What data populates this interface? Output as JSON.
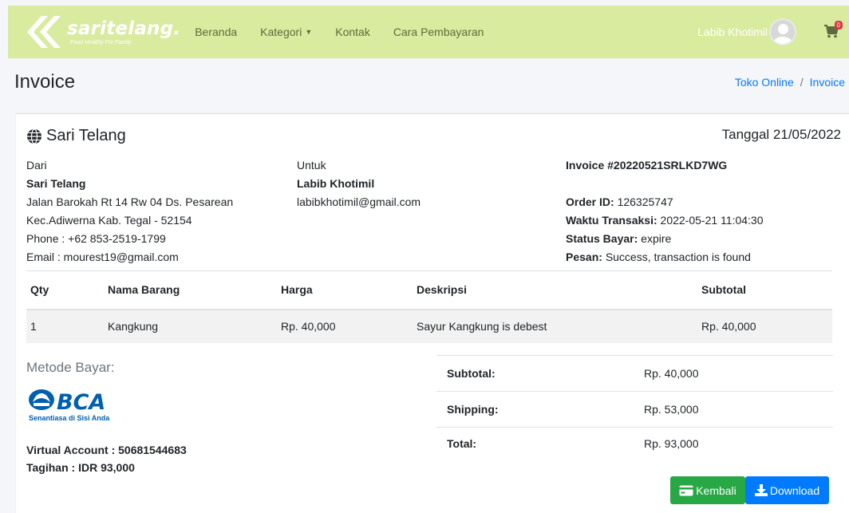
{
  "navbar": {
    "brand_name": "saritelang.",
    "brand_tagline": "Food Healthy For Family",
    "links": [
      "Beranda",
      "Kategori",
      "Kontak",
      "Cara Pembayaran"
    ],
    "user_name": "Labib Khotimil",
    "cart_count": "0",
    "bg_color": "#d9eb9e"
  },
  "page": {
    "title": "Invoice",
    "breadcrumb": [
      "Toko Online",
      "Invoice"
    ]
  },
  "invoice": {
    "shop_name": "Sari Telang",
    "date": "Tanggal 21/05/2022",
    "from": {
      "label": "Dari",
      "name": "Sari Telang",
      "address1": "Jalan Barokah Rt 14 Rw 04 Ds. Pesarean",
      "address2": "Kec.Adiwerna Kab. Tegal - 52154",
      "phone": "Phone : +62 853-2519-1799",
      "email": "Email : mourest19@gmail.com"
    },
    "to": {
      "label": "Untuk",
      "name": "Labib Khotimil",
      "email": "labibkhotimil@gmail.com"
    },
    "meta": {
      "invoice_no": "Invoice #20220521SRLKD7WG",
      "order_id_label": "Order ID:",
      "order_id": "126325747",
      "time_label": "Waktu Transaksi:",
      "time": "2022-05-21 11:04:30",
      "status_label": "Status Bayar:",
      "status": "expire",
      "message_label": "Pesan:",
      "message": "Success, transaction is found"
    },
    "table": {
      "headers": [
        "Qty",
        "Nama Barang",
        "Harga",
        "Deskripsi",
        "Subtotal"
      ],
      "rows": [
        [
          "1",
          "Kangkung",
          "Rp. 40,000",
          "Sayur Kangkung is debest",
          "Rp. 40,000"
        ]
      ]
    },
    "payment": {
      "title": "Metode Bayar:",
      "bank_logo": "BCA",
      "bank_tagline": "Senantiasa di Sisi Anda",
      "virtual_account": "Virtual Account : 50681544683",
      "bill": "Tagihan : IDR 93,000"
    },
    "totals": [
      {
        "label": "Subtotal:",
        "value": "Rp. 40,000"
      },
      {
        "label": "Shipping:",
        "value": "Rp. 53,000"
      },
      {
        "label": "Total:",
        "value": "Rp. 93,000"
      }
    ],
    "buttons": {
      "back": "Kembali",
      "download": "Download"
    }
  }
}
